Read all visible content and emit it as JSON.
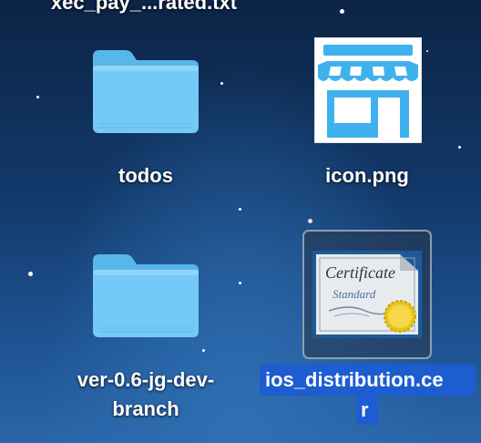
{
  "desktop": {
    "items": [
      {
        "label": "xec_pay_...rated.txt",
        "kind": "text-file"
      },
      {
        "label": "todos",
        "kind": "folder"
      },
      {
        "label": "icon.png",
        "kind": "image"
      },
      {
        "label_line1": "ver-0.6-jg-dev-",
        "label_line2": "branch",
        "kind": "folder"
      },
      {
        "label_line1": "ios_distribution.ce",
        "label_line2": "r",
        "kind": "certificate",
        "selected": true
      }
    ]
  },
  "icons": {
    "folder": "folder-icon",
    "image": "store-icon",
    "certificate": "certificate-icon"
  },
  "certificate_art": {
    "title": "Certificate",
    "subtitle": "Standard"
  },
  "colors": {
    "selection": "#1d5cd1",
    "folder": "#6cc4f4",
    "store": "#3fb2ee"
  }
}
